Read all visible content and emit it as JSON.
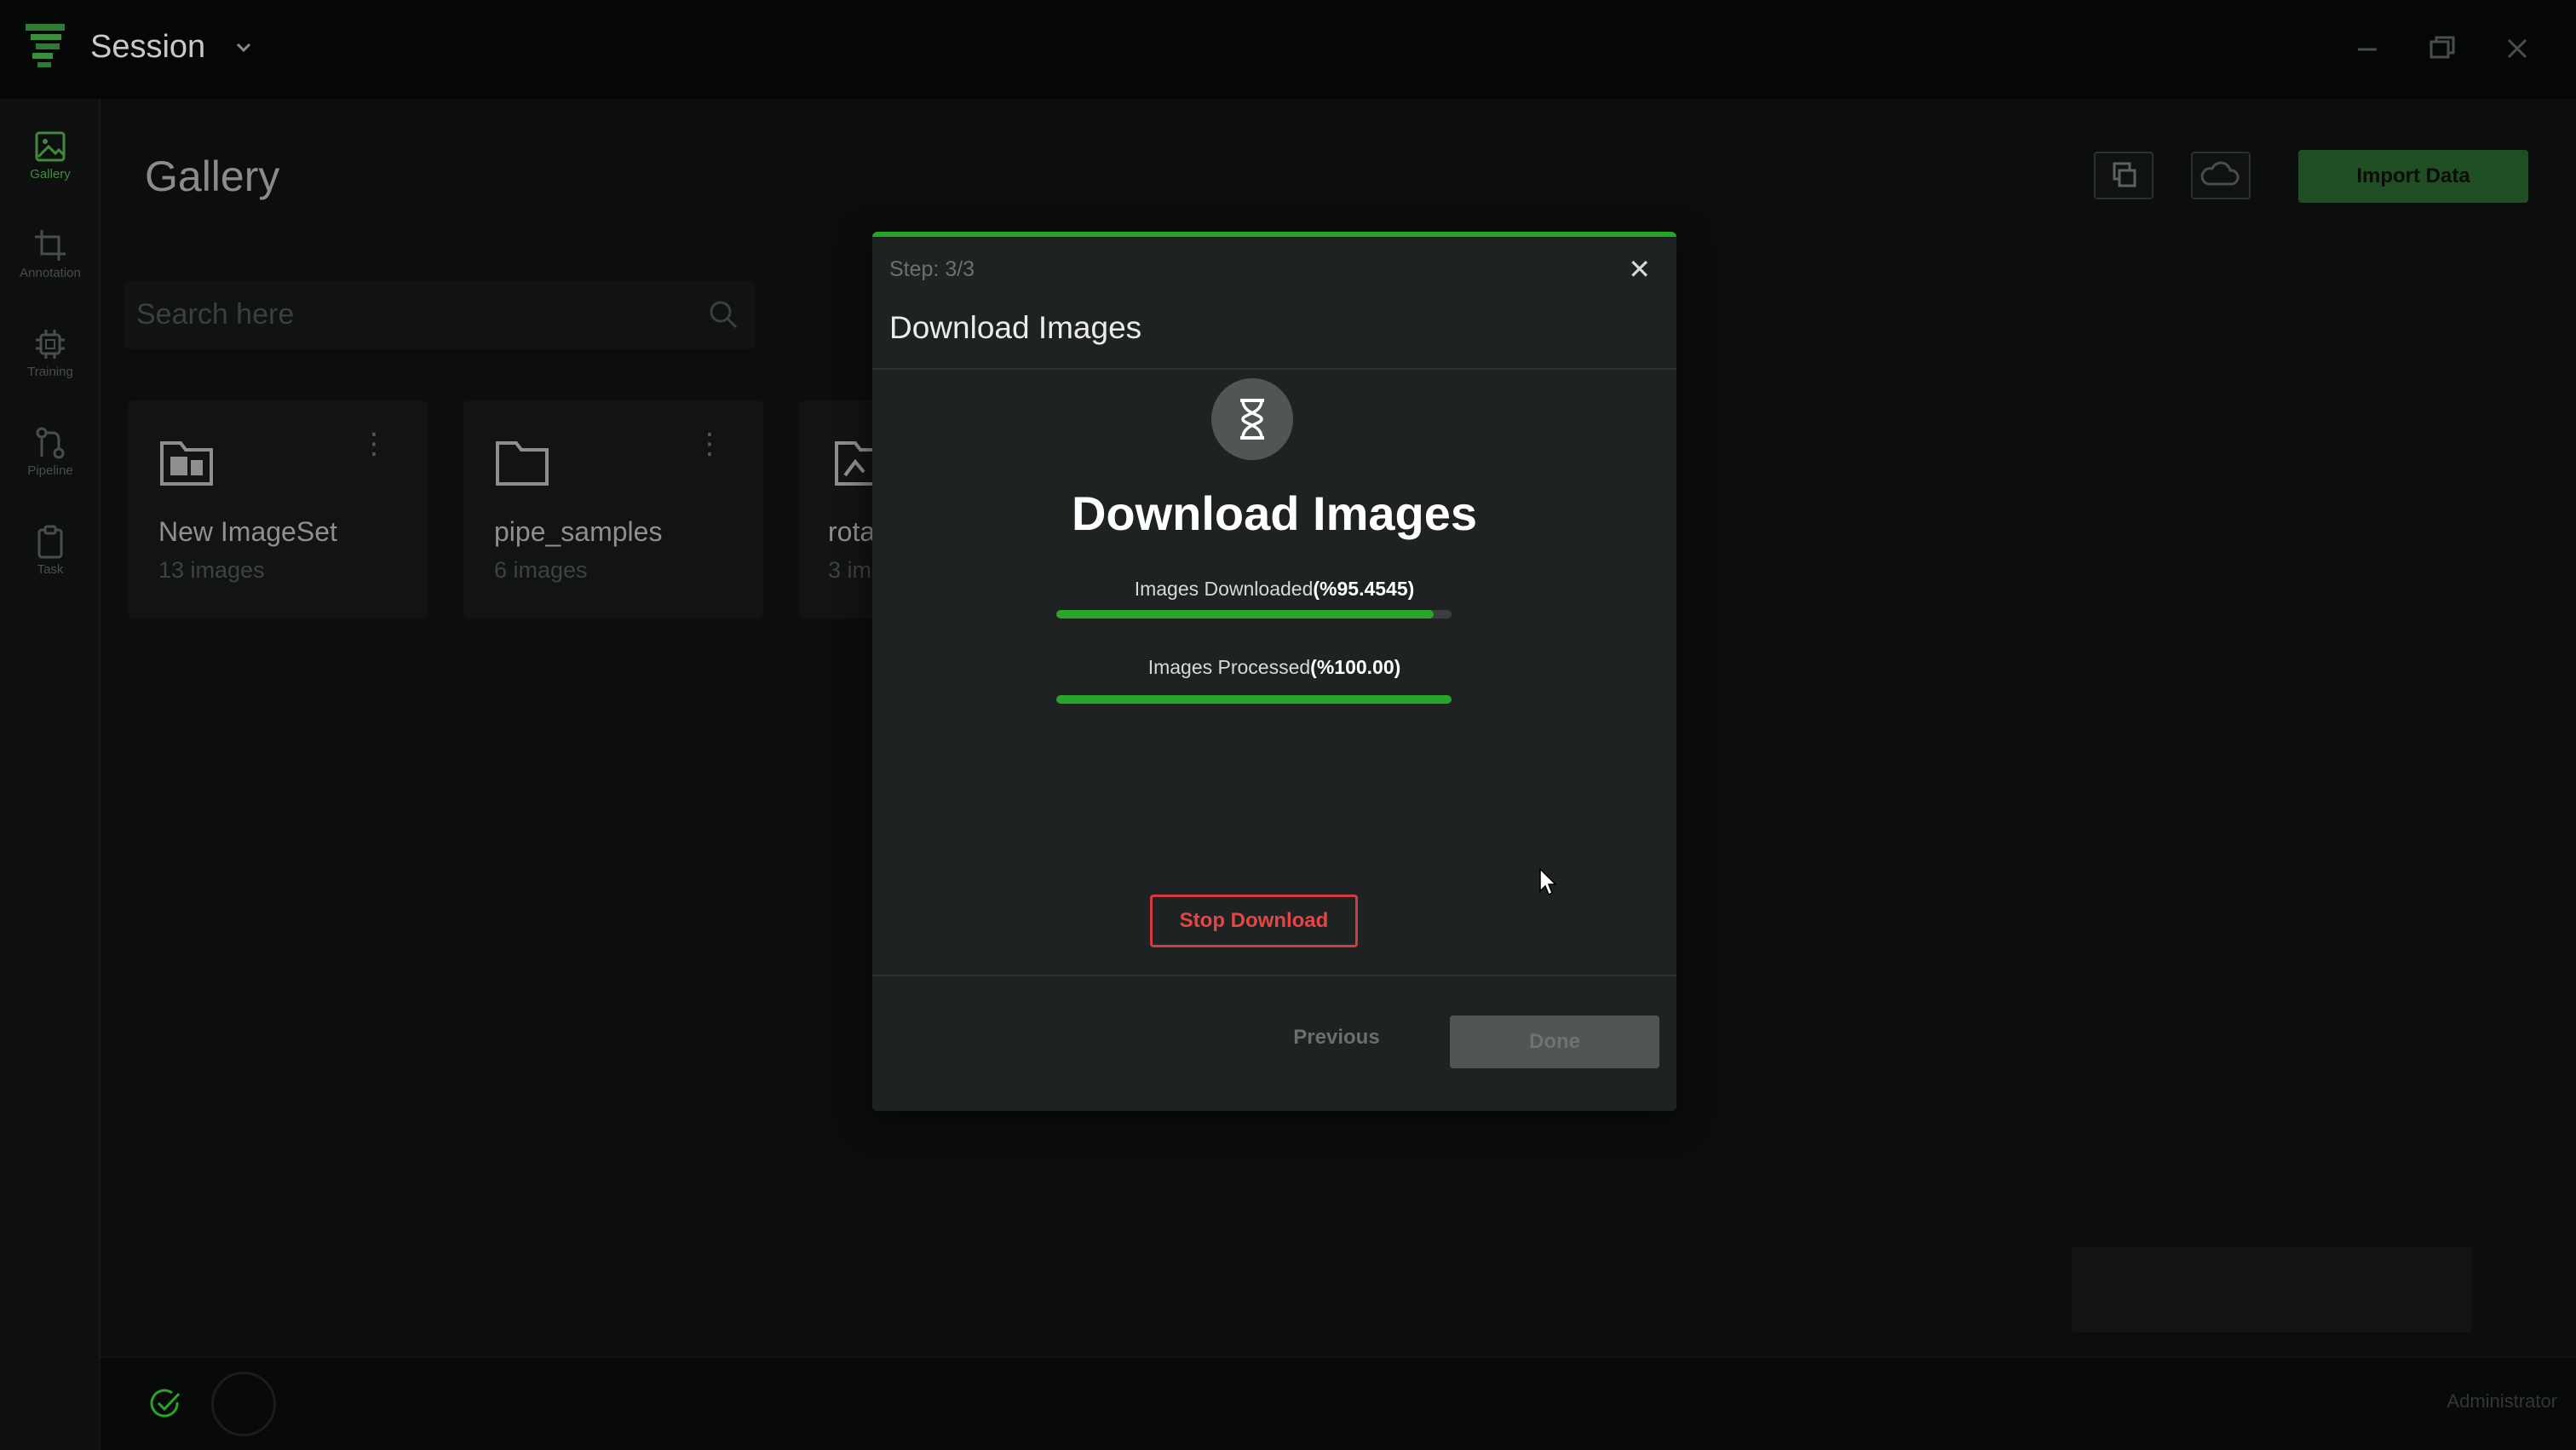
{
  "window": {
    "title": "Session",
    "controls": [
      "minimize-icon",
      "restore-icon",
      "close-icon"
    ]
  },
  "sidebar": {
    "items": [
      {
        "label": "Gallery",
        "icon": "image-icon",
        "active": true
      },
      {
        "label": "Annotation",
        "icon": "crop-icon",
        "active": false
      },
      {
        "label": "Training",
        "icon": "chip-icon",
        "active": false
      },
      {
        "label": "Pipeline",
        "icon": "pipeline-icon",
        "active": false
      },
      {
        "label": "Task",
        "icon": "clipboard-icon",
        "active": false
      }
    ]
  },
  "main": {
    "title": "Gallery",
    "search_placeholder": "Search here",
    "import_label": "Import Data",
    "cards": [
      {
        "name": "New ImageSet",
        "count": "13 images"
      },
      {
        "name": "pipe_samples",
        "count": "6 images"
      },
      {
        "name": "rota",
        "count": "3 im"
      }
    ]
  },
  "status": {
    "user": "Administrator"
  },
  "modal": {
    "step": "Step: 3/3",
    "title": "Download Images",
    "heading": "Download Images",
    "progress": [
      {
        "label": "Images Downloaded",
        "value_text": "(%95.4545)",
        "percent": 95.4545
      },
      {
        "label": "Images Processed",
        "value_text": "(%100.00)",
        "percent": 100
      }
    ],
    "stop_label": "Stop Download",
    "previous_label": "Previous",
    "done_label": "Done"
  },
  "colors": {
    "accent": "#27a327",
    "danger": "#e54545",
    "background": "#0c0d0d",
    "modal_bg": "#1f2222"
  }
}
